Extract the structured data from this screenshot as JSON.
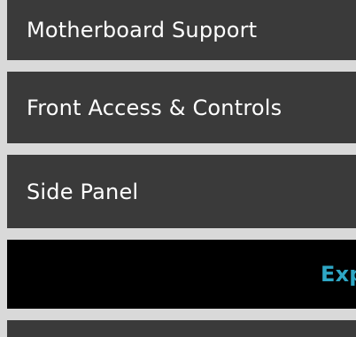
{
  "menu": {
    "items": [
      {
        "label": "Motherboard Support"
      },
      {
        "label": "Front Access & Controls"
      },
      {
        "label": "Side Panel"
      },
      {
        "label": "Exp"
      },
      {
        "label": ""
      }
    ]
  },
  "colors": {
    "page_background": "#d9d9d9",
    "item_background": "#3a3a3a",
    "item_text": "#ffffff",
    "active_background": "#000000",
    "active_text": "#2ea6c4"
  }
}
